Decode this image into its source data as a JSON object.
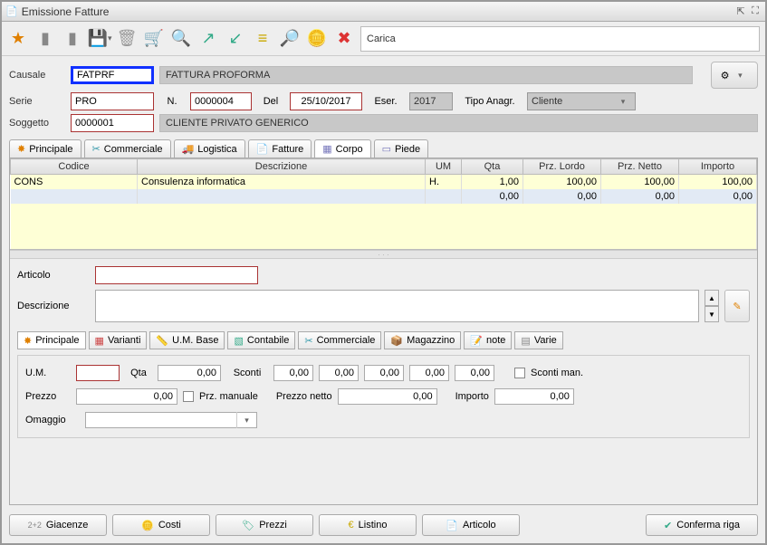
{
  "window": {
    "title": "Emissione Fatture"
  },
  "toolbar": {
    "search_value": "Carica"
  },
  "header": {
    "labels": {
      "causale": "Causale",
      "serie": "Serie",
      "numero": "N.",
      "del": "Del",
      "eser": "Eser.",
      "tipo_anagr": "Tipo Anagr.",
      "soggetto": "Soggetto"
    },
    "causale": "FATPRF",
    "causale_desc": "FATTURA PROFORMA",
    "serie": "PRO",
    "numero": "0000004",
    "del": "25/10/2017",
    "eser": "2017",
    "tipo_anagr": "Cliente",
    "soggetto": "0000001",
    "soggetto_desc": "CLIENTE PRIVATO GENERICO"
  },
  "tabs": {
    "principale": "Principale",
    "commerciale": "Commerciale",
    "logistica": "Logistica",
    "fatture": "Fatture",
    "corpo": "Corpo",
    "piede": "Piede"
  },
  "grid": {
    "headers": {
      "codice": "Codice",
      "descrizione": "Descrizione",
      "um": "UM",
      "qta": "Qta",
      "prz_lordo": "Prz. Lordo",
      "prz_netto": "Prz. Netto",
      "importo": "Importo"
    },
    "rows": [
      {
        "codice": "CONS",
        "descrizione": "Consulenza informatica",
        "um": "H.",
        "qta": "1,00",
        "prz_lordo": "100,00",
        "prz_netto": "100,00",
        "importo": "100,00"
      },
      {
        "codice": "",
        "descrizione": "",
        "um": "",
        "qta": "0,00",
        "prz_lordo": "0,00",
        "prz_netto": "0,00",
        "importo": "0,00"
      }
    ]
  },
  "detail": {
    "labels": {
      "articolo": "Articolo",
      "descrizione": "Descrizione"
    },
    "articolo": "",
    "subtabs": {
      "principale": "Principale",
      "varianti": "Varianti",
      "um_base": "U.M. Base",
      "contabile": "Contabile",
      "commerciale": "Commerciale",
      "magazzino": "Magazzino",
      "note": "note",
      "varie": "Varie"
    },
    "fields_labels": {
      "um": "U.M.",
      "qta": "Qta",
      "sconti": "Sconti",
      "sconti_man": "Sconti man.",
      "prezzo": "Prezzo",
      "prz_manuale": "Prz. manuale",
      "prezzo_netto": "Prezzo netto",
      "importo": "Importo",
      "omaggio": "Omaggio"
    },
    "um": "",
    "qta": "0,00",
    "sconti": [
      "0,00",
      "0,00",
      "0,00",
      "0,00",
      "0,00"
    ],
    "prezzo": "0,00",
    "prezzo_netto": "0,00",
    "importo": "0,00",
    "omaggio": ""
  },
  "bottom": {
    "giacenze": "Giacenze",
    "giacenze_pre": "2+2",
    "costi": "Costi",
    "prezzi": "Prezzi",
    "listino": "Listino",
    "articolo": "Articolo",
    "conferma": "Conferma riga"
  }
}
